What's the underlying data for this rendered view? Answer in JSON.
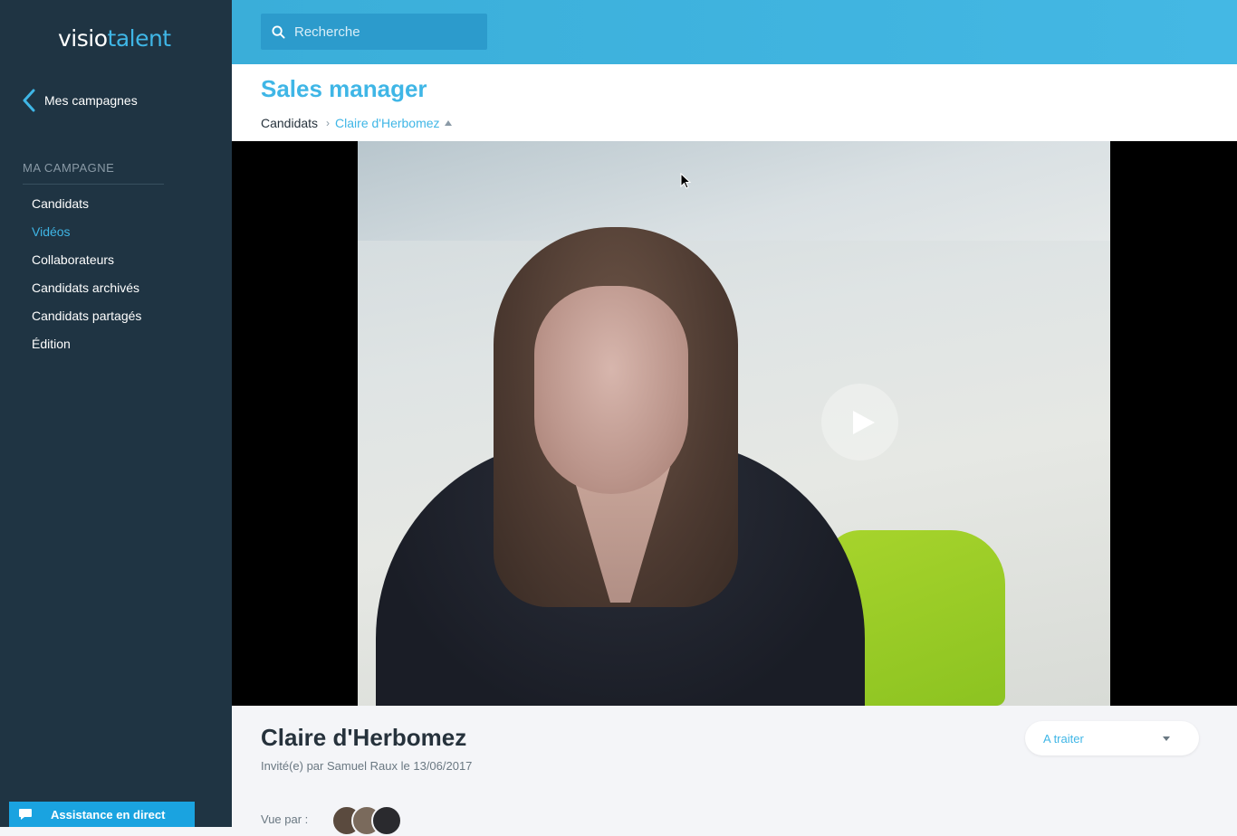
{
  "app": {
    "logo_part1": "visio",
    "logo_part2": "talent"
  },
  "sidebar": {
    "back_label": "Mes campagnes",
    "section_title": "MA CAMPAGNE",
    "items": [
      {
        "label": "Candidats",
        "active": false
      },
      {
        "label": "Vidéos",
        "active": true
      },
      {
        "label": "Collaborateurs",
        "active": false
      },
      {
        "label": "Candidats archivés",
        "active": false
      },
      {
        "label": "Candidats partagés",
        "active": false
      },
      {
        "label": "Édition",
        "active": false
      }
    ],
    "assist_label": "Assistance en direct"
  },
  "search": {
    "placeholder": "Recherche"
  },
  "page": {
    "title": "Sales manager",
    "breadcrumb": {
      "root": "Candidats",
      "current": "Claire d'Herbomez"
    }
  },
  "candidate": {
    "name": "Claire d'Herbomez",
    "invited_text": "Invité(e) par Samuel Raux le 13/06/2017",
    "seen_by_label": "Vue par :",
    "status": "A traiter"
  },
  "colors": {
    "accent": "#3fb6e6",
    "sidebar": "#1f3443",
    "topbar": "#3aaed9",
    "assist": "#1aa3e0"
  }
}
